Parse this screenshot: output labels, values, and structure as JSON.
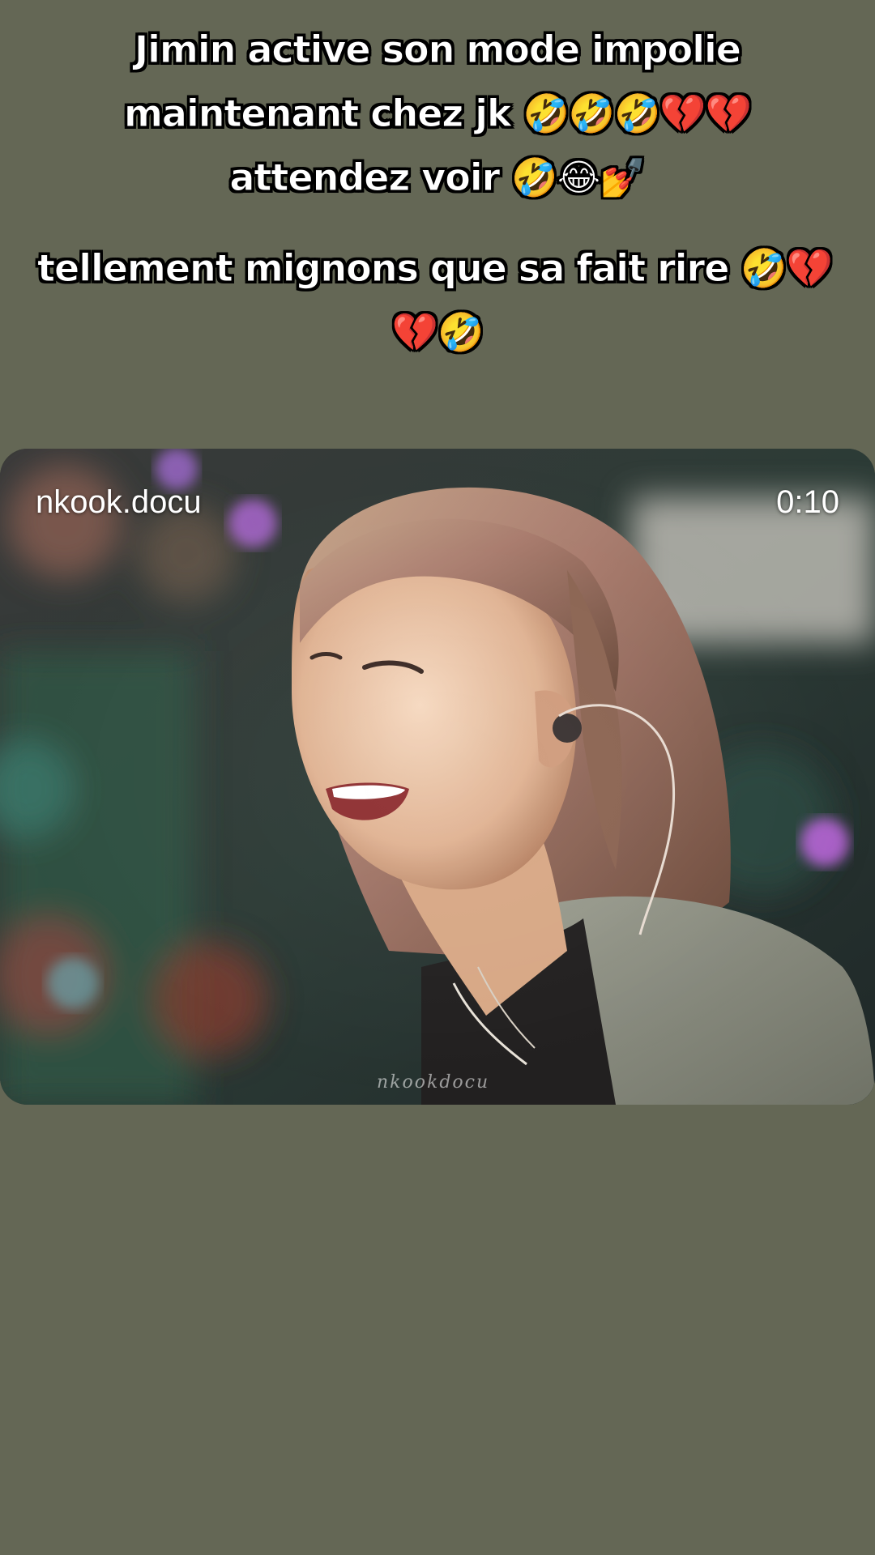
{
  "caption": {
    "top_lines": [
      "Jimin active son mode impolie",
      "maintenant chez jk 🤣🤣🤣💔💔",
      "attendez voir 🤣😂💅"
    ],
    "mid_line_1": "tellement mignons que sa fait rire 🤣💔",
    "mid_line_2": "💔🤣"
  },
  "video": {
    "channel": "nkook.docu",
    "duration": "0:10",
    "watermark": "nkookdocu"
  },
  "colors": {
    "background": "#646755",
    "caption_text": "#ffffff",
    "caption_outline": "#000000"
  }
}
